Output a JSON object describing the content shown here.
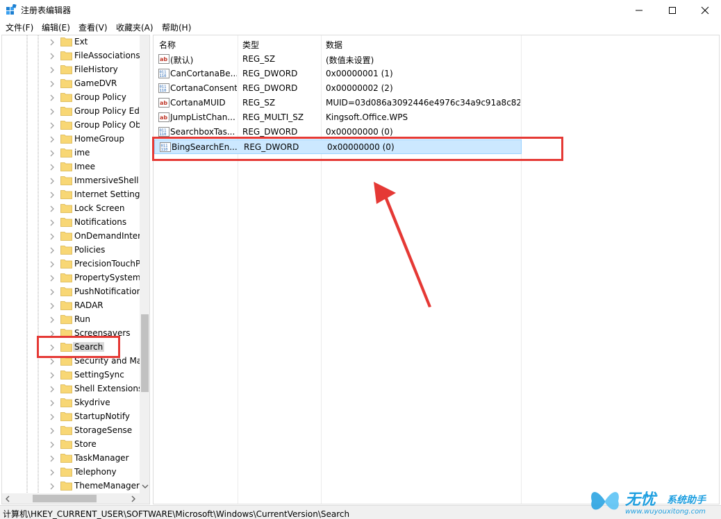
{
  "window": {
    "title": "注册表编辑器"
  },
  "menu": [
    "文件(F)",
    "编辑(E)",
    "查看(V)",
    "收藏夹(A)",
    "帮助(H)"
  ],
  "tree": {
    "items": [
      {
        "label": "Ext"
      },
      {
        "label": "FileAssociations"
      },
      {
        "label": "FileHistory"
      },
      {
        "label": "GameDVR"
      },
      {
        "label": "Group Policy"
      },
      {
        "label": "Group Policy Ed"
      },
      {
        "label": "Group Policy Ob"
      },
      {
        "label": "HomeGroup"
      },
      {
        "label": "ime"
      },
      {
        "label": "Imee"
      },
      {
        "label": "ImmersiveShell"
      },
      {
        "label": "Internet Settings"
      },
      {
        "label": "Lock Screen"
      },
      {
        "label": "Notifications"
      },
      {
        "label": "OnDemandInter"
      },
      {
        "label": "Policies"
      },
      {
        "label": "PrecisionTouchP"
      },
      {
        "label": "PropertySystem"
      },
      {
        "label": "PushNotification"
      },
      {
        "label": "RADAR"
      },
      {
        "label": "Run"
      },
      {
        "label": "Screensavers"
      },
      {
        "label": "Search"
      },
      {
        "label": "Security and Ma"
      },
      {
        "label": "SettingSync"
      },
      {
        "label": "Shell Extensions"
      },
      {
        "label": "Skydrive"
      },
      {
        "label": "StartupNotify"
      },
      {
        "label": "StorageSense"
      },
      {
        "label": "Store"
      },
      {
        "label": "TaskManager"
      },
      {
        "label": "Telephony"
      },
      {
        "label": "ThemeManager"
      }
    ],
    "selected": "Search"
  },
  "list": {
    "columns": [
      "名称",
      "类型",
      "数据"
    ],
    "rows": [
      {
        "name": "(默认)",
        "type": "REG_SZ",
        "data": "(数值未设置)",
        "icon": "string-value-icon"
      },
      {
        "name": "CanCortanaBe...",
        "type": "REG_DWORD",
        "data": "0x00000001 (1)",
        "icon": "binary-value-icon"
      },
      {
        "name": "CortanaConsent",
        "type": "REG_DWORD",
        "data": "0x00000002 (2)",
        "icon": "binary-value-icon"
      },
      {
        "name": "CortanaMUID",
        "type": "REG_SZ",
        "data": "MUID=03d086a3092446e4976c34a9c91a8c82",
        "icon": "string-value-icon"
      },
      {
        "name": "JumpListChan...",
        "type": "REG_MULTI_SZ",
        "data": "Kingsoft.Office.WPS",
        "icon": "string-value-icon"
      },
      {
        "name": "SearchboxTas...",
        "type": "REG_DWORD",
        "data": "0x00000000 (0)",
        "icon": "binary-value-icon"
      },
      {
        "name": "BingSearchEn...",
        "type": "REG_DWORD",
        "data": "0x00000000 (0)",
        "icon": "binary-value-icon"
      }
    ],
    "selected_row": 6
  },
  "status": {
    "path": "计算机\\HKEY_CURRENT_USER\\SOFTWARE\\Microsoft\\Windows\\CurrentVersion\\Search"
  },
  "watermark": {
    "brand": "无忧",
    "slogan": "系统助手",
    "url": "www.wuyouxitong.com"
  },
  "colors": {
    "annotation_red": "#e53935",
    "selection_blue": "#cce8ff",
    "folder_yellow": "#f8d775",
    "watermark_blue": "#1e9fe0"
  }
}
